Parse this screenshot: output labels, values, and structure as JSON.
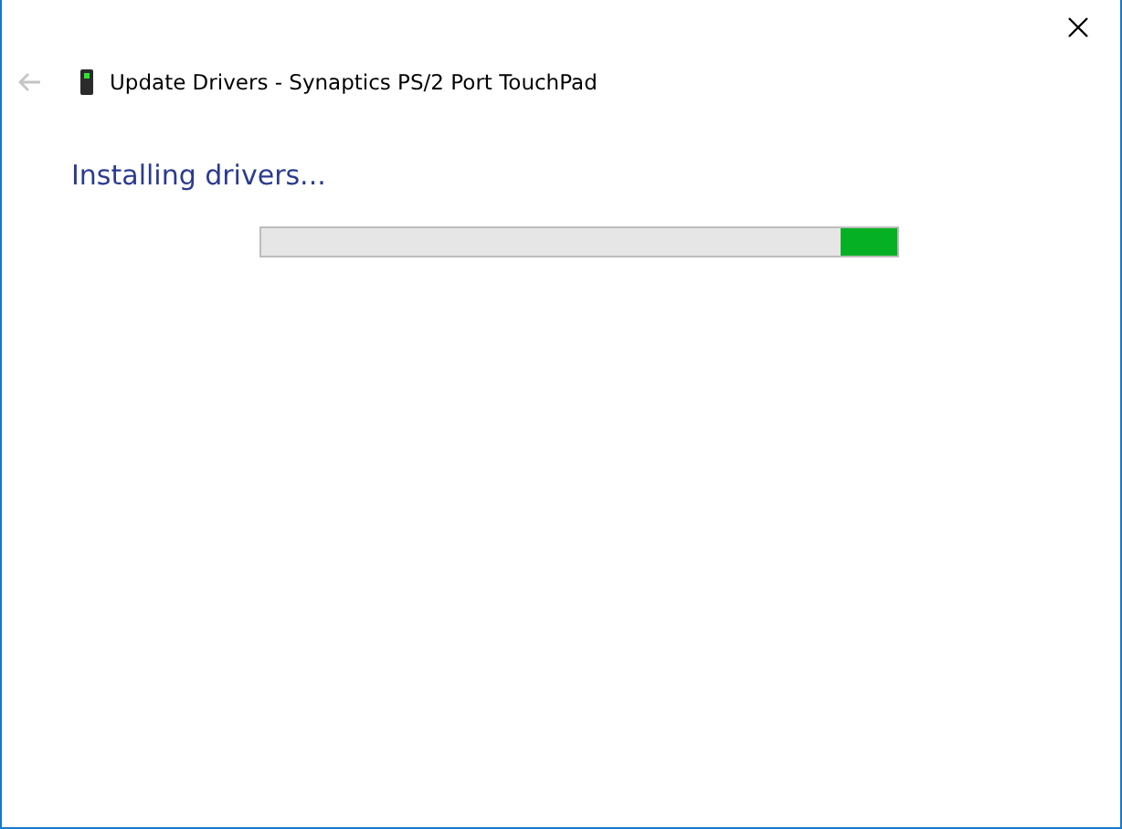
{
  "window": {
    "title": "Update Drivers - Synaptics PS/2 Port TouchPad"
  },
  "back_button": {
    "disabled": true
  },
  "heading": "Installing drivers...",
  "progress": {
    "level": 0.09
  }
}
